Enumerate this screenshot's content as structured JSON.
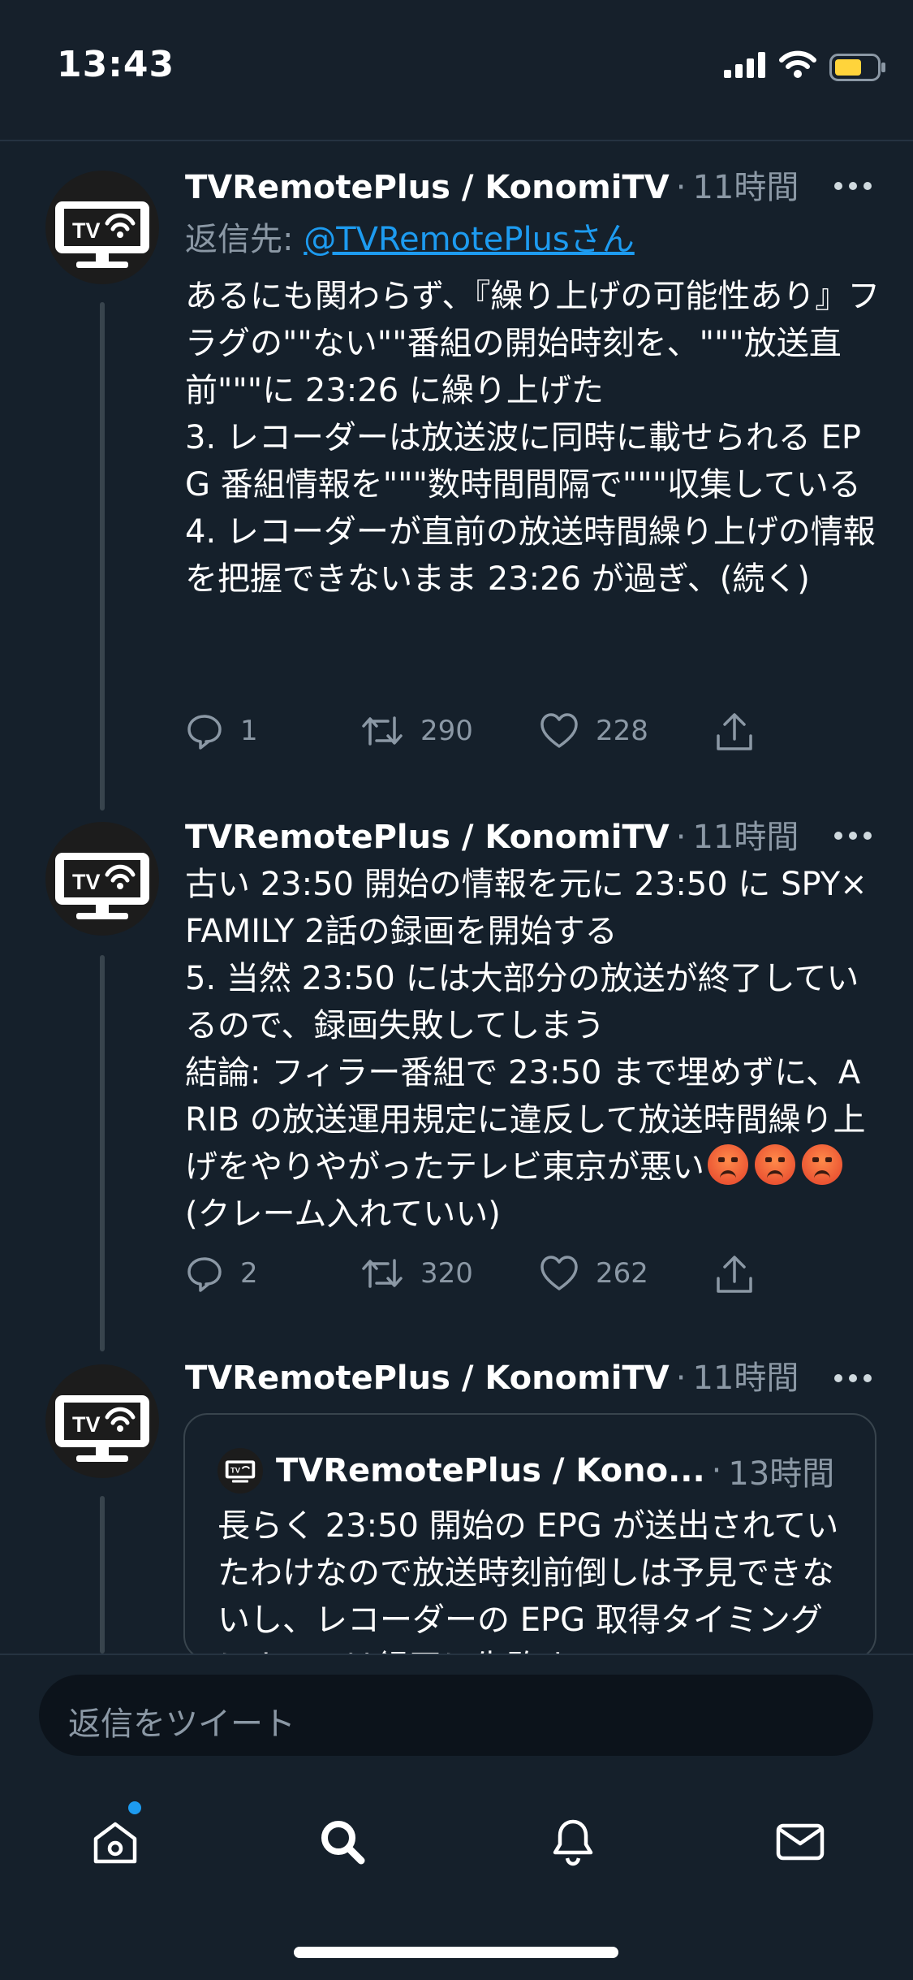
{
  "status_bar": {
    "time": "13:43",
    "battery_color": "#ffd43b"
  },
  "tweets": [
    {
      "name": "TVRemotePlus / KonomiTV",
      "separator": "·",
      "time": "11時間",
      "reply_label": "返信先: ",
      "reply_handle": "@TVRemotePlusさん",
      "text": "あるにも関わらず、『繰り上げの可能性あり』フラグの\"\"ない\"\"番組の開始時刻を、\"\"\"放送直前\"\"\"に 23:26 に繰り上げた\n3. レコーダーは放送波に同時に載せられる EPG 番組情報を\"\"\"数時間間隔で\"\"\"収集している\n4. レコーダーが直前の放送時間繰り上げの情報を把握できないまま 23:26 が過ぎ、(続く)",
      "replies": "1",
      "retweets": "290",
      "likes": "228"
    },
    {
      "name": "TVRemotePlus / KonomiTV",
      "separator": "·",
      "time": "11時間",
      "text": "古い 23:50 開始の情報を元に 23:50 に SPY×FAMILY 2話の録画を開始する\n5. 当然 23:50 には大部分の放送が終了しているので、録画失敗してしまう\n結論: フィラー番組で 23:50 まで埋めずに、ARIB の放送運用規定に違反して放送時間繰り上げをやりやがったテレビ東京が悪い",
      "text_tail": "(クレーム入れていい)",
      "emoji": [
        "pouting-face",
        "pouting-face",
        "pouting-face"
      ],
      "replies": "2",
      "retweets": "320",
      "likes": "262"
    },
    {
      "name": "TVRemotePlus / KonomiTV",
      "separator": "·",
      "time": "11時間",
      "quote": {
        "name": "TVRemotePlus / Kono...",
        "separator": "·",
        "time": "13時間",
        "text": "長らく 23:50 開始の EPG が送出されていたわけなので放送時刻前倒しは予見できないし、レコーダーの EPG 取得タイミングによっては録画に失敗する"
      }
    }
  ],
  "composer": {
    "placeholder": "返信をツイート"
  },
  "tabbar": {
    "items": [
      "home-icon",
      "search-icon",
      "notifications-icon",
      "messages-icon"
    ],
    "accent": "#1d9bf0"
  }
}
